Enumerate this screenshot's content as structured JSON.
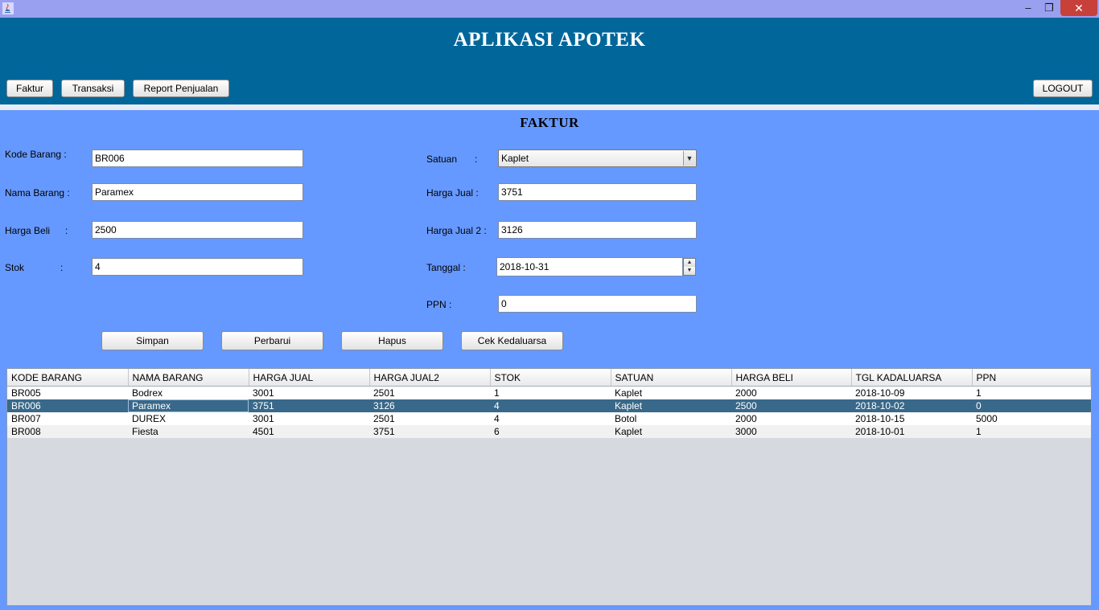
{
  "window": {
    "minimize_glyph": "–",
    "maximize_glyph": "❐",
    "close_glyph": "✕",
    "icon": "java-coffee-icon"
  },
  "header": {
    "title": "APLIKASI APOTEK",
    "nav": [
      "Faktur",
      "Transaksi",
      "Report Penjualan"
    ],
    "logout_label": "LOGOUT"
  },
  "form": {
    "title": "FAKTUR",
    "kode_barang": {
      "label": "Kode Barang  :",
      "value": "BR006"
    },
    "nama_barang": {
      "label": "Nama Barang :",
      "value": "Paramex"
    },
    "harga_beli": {
      "label": "Harga Beli",
      "colon": ":",
      "value": "2500"
    },
    "stok": {
      "label": "Stok",
      "colon": ":",
      "value": "4"
    },
    "satuan": {
      "label": "Satuan",
      "colon": ":",
      "value": "Kaplet"
    },
    "harga_jual": {
      "label": "Harga Jual :",
      "value": "3751"
    },
    "harga_jual2": {
      "label": "Harga Jual 2 :",
      "value": "3126"
    },
    "tanggal": {
      "label": "Tanggal :",
      "value": "2018-10-31"
    },
    "ppn": {
      "label": "PPN :",
      "value": "0"
    }
  },
  "actions": {
    "simpan": "Simpan",
    "perbarui": "Perbarui",
    "hapus": "Hapus",
    "cek": "Cek Kedaluarsa"
  },
  "table": {
    "columns": [
      "KODE BARANG",
      "NAMA BARANG",
      "HARGA JUAL",
      "HARGA JUAL2",
      "STOK",
      "SATUAN",
      "HARGA BELI",
      "TGL KADALUARSA",
      "PPN"
    ],
    "rows": [
      [
        "BR005",
        "Bodrex",
        "3001",
        "2501",
        "1",
        "Kaplet",
        "2000",
        "2018-10-09",
        "1"
      ],
      [
        "BR006",
        "Paramex",
        "3751",
        "3126",
        "4",
        "Kaplet",
        "2500",
        "2018-10-02",
        "0"
      ],
      [
        "BR007",
        "DUREX",
        "3001",
        "2501",
        "4",
        "Botol",
        "2000",
        "2018-10-15",
        "5000"
      ],
      [
        "BR008",
        "Fiesta",
        "4501",
        "3751",
        "6",
        "Kaplet",
        "3000",
        "2018-10-01",
        "1"
      ]
    ],
    "selected_row": 1
  },
  "colors": {
    "form_bg": "#6699ff",
    "header_bg": "#016699",
    "selected_row": "#39698a"
  }
}
